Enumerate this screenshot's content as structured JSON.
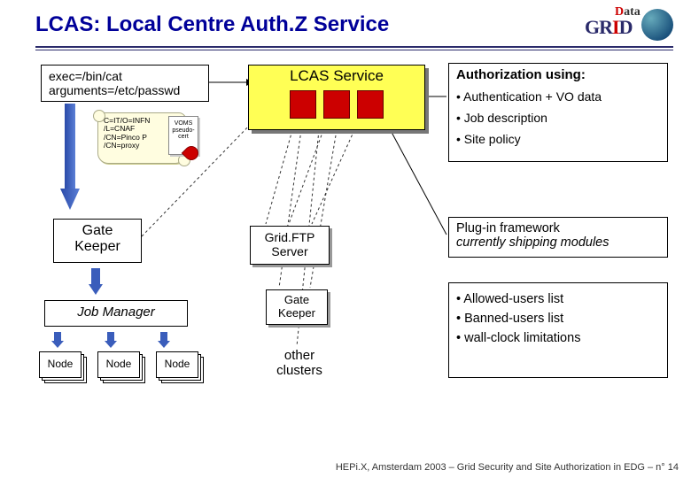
{
  "title": "LCAS: Local Centre Auth.Z Service",
  "logo": {
    "top": "Data",
    "bottom": "GRID"
  },
  "exec": {
    "line1": "exec=/bin/cat",
    "line2": "arguments=/etc/passwd"
  },
  "cert": {
    "l1": "C=IT/O=INFN",
    "l2": "/L=CNAF",
    "l3": "/CN=Pinco P",
    "l4": "/CN=proxy"
  },
  "voms": {
    "l1": "VOMS",
    "l2": "pseudo-",
    "l3": "cert"
  },
  "lcas": {
    "label": "LCAS Service"
  },
  "auth": {
    "heading": "Authorization using:",
    "b1": "• Authentication + VO data",
    "b2": "• Job description",
    "b3": "• Site policy"
  },
  "gate": {
    "l1": "Gate",
    "l2": "Keeper"
  },
  "gridftp": {
    "l1": "Grid.FTP",
    "l2": "Server"
  },
  "gate2": {
    "l1": "Gate",
    "l2": "Keeper"
  },
  "other": {
    "l1": "other",
    "l2": "clusters"
  },
  "plugin": {
    "l1": "Plug-in framework",
    "l2": "currently shipping modules"
  },
  "limits": {
    "b1": "• Allowed-users list",
    "b2": "• Banned-users list",
    "b3": "• wall-clock limitations"
  },
  "jobmgr": "Job Manager",
  "node": "Node",
  "footer": "HEPi.X, Amsterdam 2003 – Grid Security and Site Authorization in EDG – n° 14"
}
